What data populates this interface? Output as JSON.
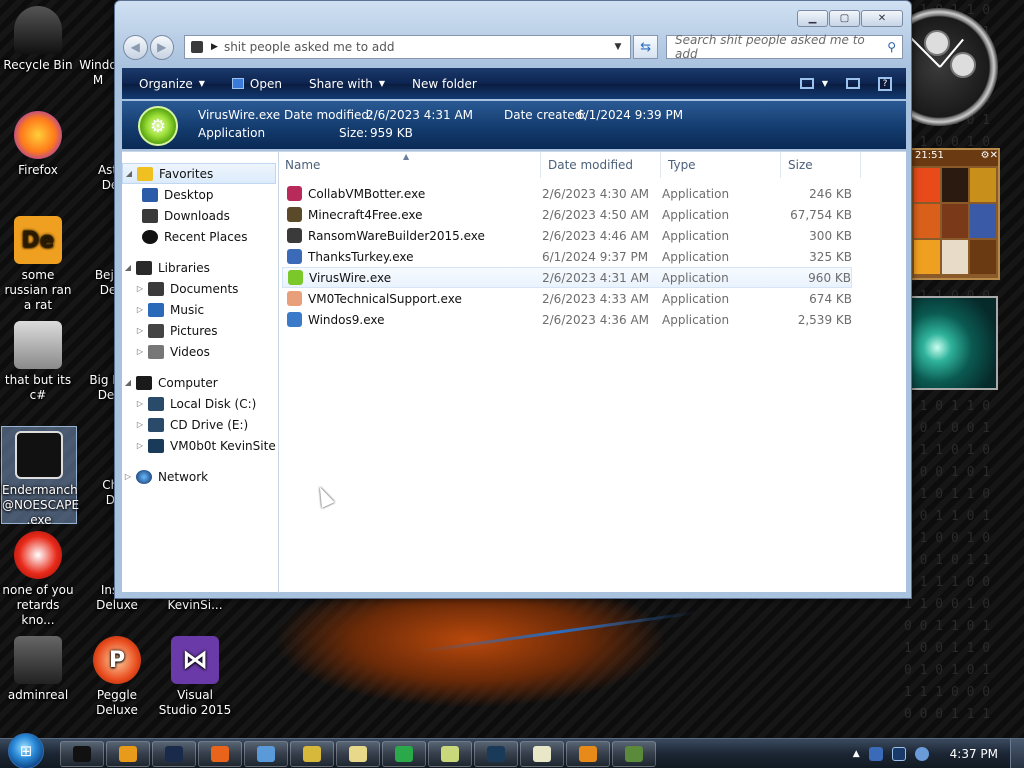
{
  "desktop": {
    "icons": [
      {
        "label": "Recycle Bin",
        "color": "#2a2a2a"
      },
      {
        "label": "Firefox",
        "color": "#e8641a"
      },
      {
        "label": "some russian ran a rat",
        "color": "#e88a1c"
      },
      {
        "label": "that but its c#",
        "color": "#9a9a9a"
      },
      {
        "label": "Endermanch @NOESCAPE .exe",
        "color": "#222222"
      },
      {
        "label": "none of you retards kno...",
        "color": "#d8281c"
      },
      {
        "label": "adminreal",
        "color": "#444444"
      },
      {
        "label": "Peggle Deluxe",
        "color": "#e84a1c"
      },
      {
        "label": "Visual Studio 2015",
        "color": "#6a3aa8"
      }
    ],
    "partial_icons": [
      {
        "label": "Windo M"
      },
      {
        "label": "Astr De"
      },
      {
        "label": "Beje De"
      },
      {
        "label": "Big M De"
      },
      {
        "label": "Chu De"
      },
      {
        "label": "Insan Deluxe"
      },
      {
        "label": "KevinSi..."
      }
    ],
    "gadget_time": "21:51"
  },
  "window": {
    "address": {
      "path": "shit people asked me to add"
    },
    "search": {
      "placeholder": "Search shit people asked me to add"
    },
    "commands": {
      "organize": "Organize",
      "open": "Open",
      "share_with": "Share with",
      "new_folder": "New folder"
    },
    "details": {
      "name": "VirusWire.exe",
      "date_modified_label": "Date modified:",
      "date_modified": "2/6/2023 4:31 AM",
      "date_created_label": "Date created:",
      "date_created": "6/1/2024 9:39 PM",
      "type": "Application",
      "size_label": "Size:",
      "size": "959 KB"
    },
    "nav": {
      "favorites": "Favorites",
      "desktop": "Desktop",
      "downloads": "Downloads",
      "recent_places": "Recent Places",
      "libraries": "Libraries",
      "documents": "Documents",
      "music": "Music",
      "pictures": "Pictures",
      "videos": "Videos",
      "computer": "Computer",
      "local_disk": "Local Disk (C:)",
      "cd_drive": "CD Drive (E:)",
      "network_drive": "VM0b0t KevinSite",
      "network": "Network"
    },
    "columns": {
      "name": "Name",
      "date_modified": "Date modified",
      "type": "Type",
      "size": "Size"
    },
    "files": [
      {
        "name": "CollabVMBotter.exe",
        "date": "2/6/2023 4:30 AM",
        "type": "Application",
        "size": "246 KB",
        "icon_color": "#b82a5a"
      },
      {
        "name": "Minecraft4Free.exe",
        "date": "2/6/2023 4:50 AM",
        "type": "Application",
        "size": "67,754 KB",
        "icon_color": "#5a4a2a"
      },
      {
        "name": "RansomWareBuilder2015.exe",
        "date": "2/6/2023 4:46 AM",
        "type": "Application",
        "size": "300 KB",
        "icon_color": "#3a3a3a"
      },
      {
        "name": "ThanksTurkey.exe",
        "date": "6/1/2024 9:37 PM",
        "type": "Application",
        "size": "325 KB",
        "icon_color": "#3a6ab8"
      },
      {
        "name": "VirusWire.exe",
        "date": "2/6/2023 4:31 AM",
        "type": "Application",
        "size": "960 KB",
        "icon_color": "#7ac82a"
      },
      {
        "name": "VM0TechnicalSupport.exe",
        "date": "2/6/2023 4:33 AM",
        "type": "Application",
        "size": "674 KB",
        "icon_color": "#e8a07a"
      },
      {
        "name": "Windos9.exe",
        "date": "2/6/2023 4:36 AM",
        "type": "Application",
        "size": "2,539 KB",
        "icon_color": "#3a7ac8"
      }
    ]
  },
  "taskbar": {
    "clock": "4:37 PM",
    "buttons": [
      "black-window",
      "media-player",
      "circle-app",
      "firefox",
      "users",
      "files",
      "notepad",
      "h-app",
      "folder",
      "terminal",
      "notes",
      "ball",
      "minecraft"
    ]
  }
}
